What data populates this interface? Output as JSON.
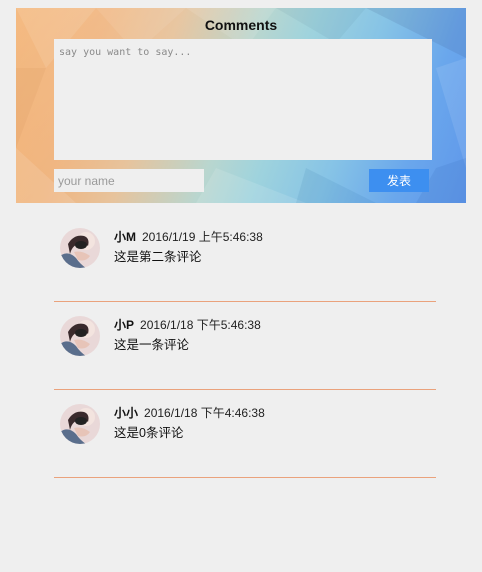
{
  "comment_form": {
    "title": "Comments",
    "content_placeholder": "say you want to say...",
    "name_placeholder": "your name",
    "submit_label": "发表"
  },
  "comments": [
    {
      "author": "小M",
      "time": "2016/1/19 上午5:46:38",
      "text": "这是第二条评论"
    },
    {
      "author": "小P",
      "time": "2016/1/18 下午5:46:38",
      "text": "这是一条评论"
    },
    {
      "author": "小小",
      "time": "2016/1/18 下午4:46:38",
      "text": "这是0条评论"
    }
  ],
  "colors": {
    "accent_button": "#3d8ff0",
    "divider": "#eaa27c",
    "page_background": "#efefef"
  }
}
